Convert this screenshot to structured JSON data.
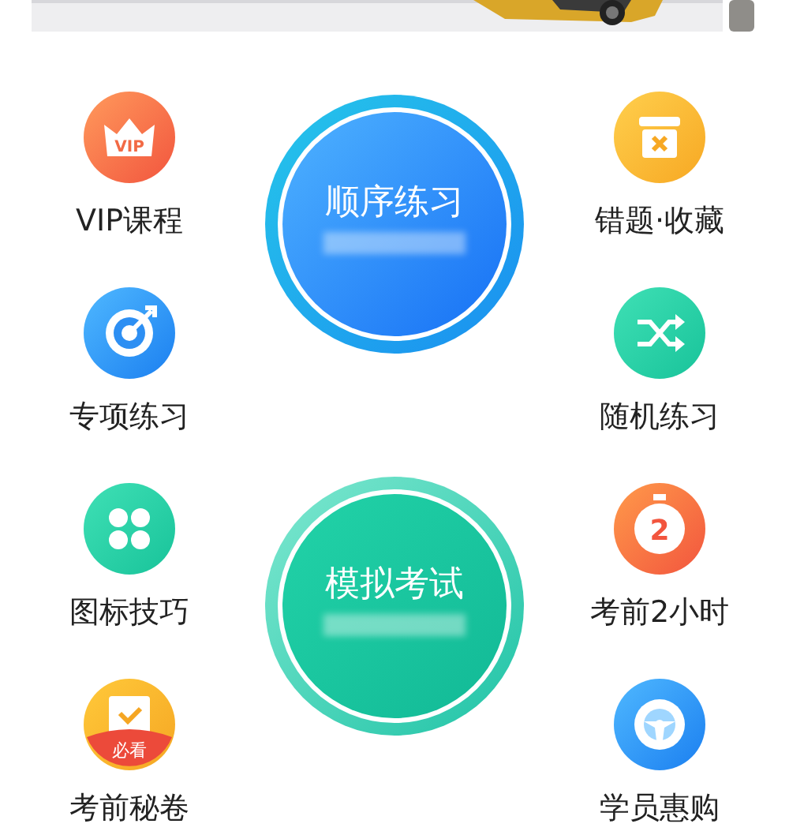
{
  "left_items": [
    {
      "label": "VIP课程",
      "kind": "vip",
      "icon_text": "VIP"
    },
    {
      "label": "专项练习",
      "kind": "target"
    },
    {
      "label": "图标技巧",
      "kind": "dots"
    },
    {
      "label": "考前秘卷",
      "kind": "must",
      "icon_text": "必看"
    }
  ],
  "right_items": [
    {
      "label": "错题·收藏",
      "kind": "box"
    },
    {
      "label": "随机练习",
      "kind": "shuffle"
    },
    {
      "label": "考前2小时",
      "kind": "clock",
      "icon_text": "2"
    },
    {
      "label": "学员惠购",
      "kind": "wheel"
    }
  ],
  "main_buttons": [
    {
      "label": "顺序练习",
      "kind": "blue"
    },
    {
      "label": "模拟考试",
      "kind": "green"
    }
  ]
}
